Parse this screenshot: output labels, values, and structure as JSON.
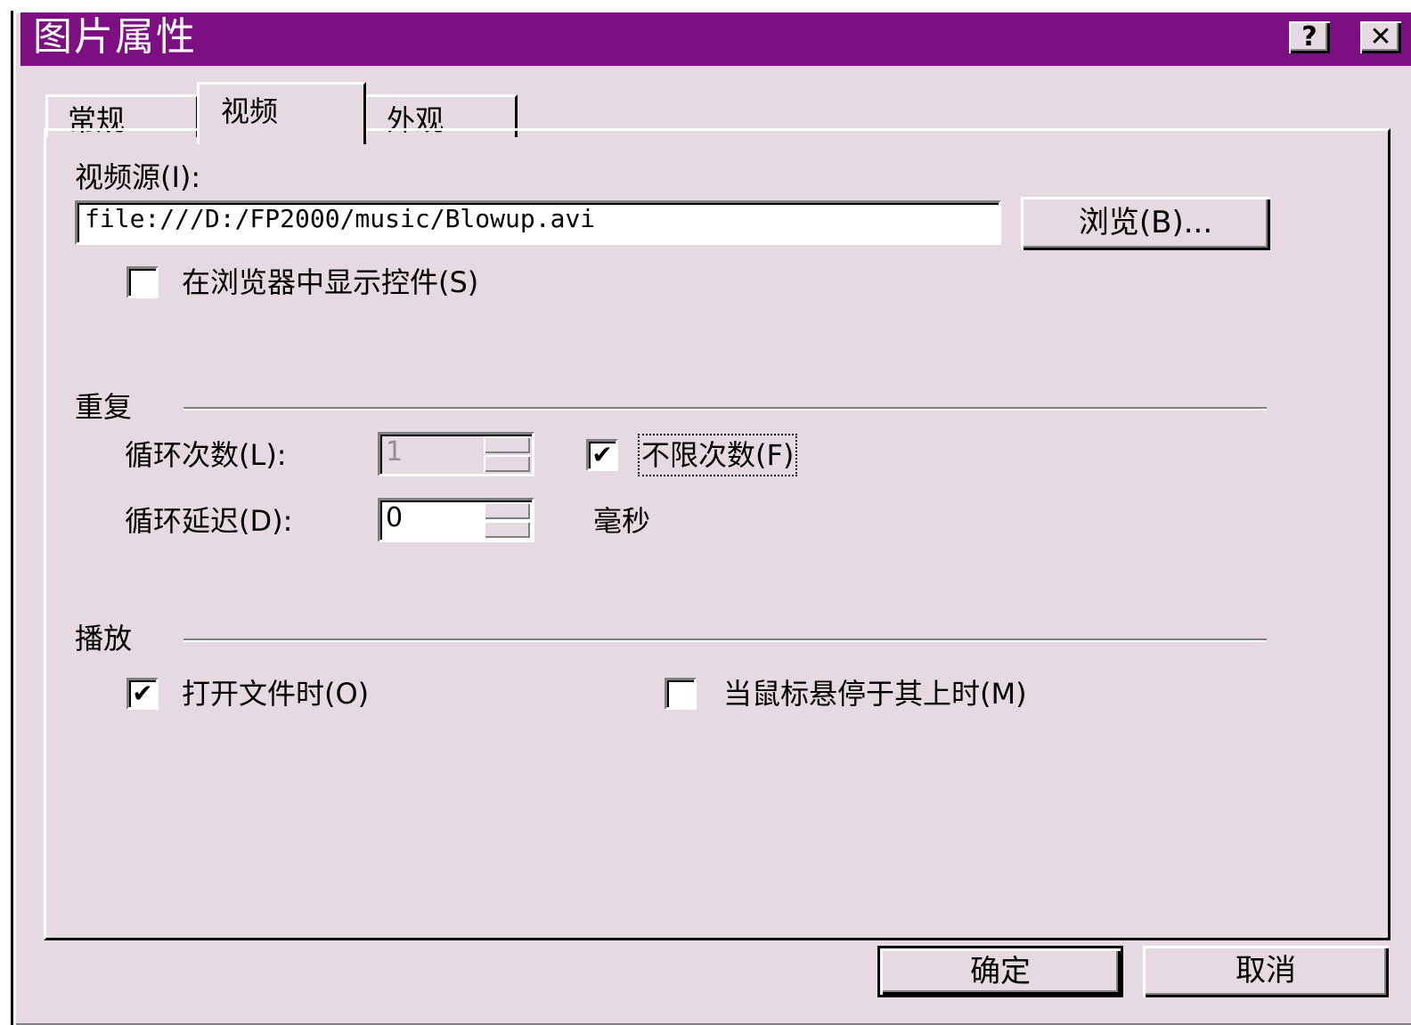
{
  "window": {
    "title": "图片属性",
    "help_button": "?",
    "close_button": "✕"
  },
  "tabs": [
    {
      "label": "常规",
      "active": false
    },
    {
      "label": "视频",
      "active": true
    },
    {
      "label": "外观",
      "active": false
    }
  ],
  "video": {
    "source_label": "视频源(I):",
    "source_value": "file:///D:/FP2000/music/Blowup.avi",
    "browse_button": "浏览(B)...",
    "show_controls_label": "在浏览器中显示控件(S)",
    "show_controls_checked": false
  },
  "repeat": {
    "group_label": "重复",
    "loop_count_label": "循环次数(L):",
    "loop_count_value": "1",
    "loop_count_disabled": true,
    "infinite_label": "不限次数(F)",
    "infinite_checked": true,
    "loop_delay_label": "循环延迟(D):",
    "loop_delay_value": "0",
    "loop_delay_unit": "毫秒"
  },
  "play": {
    "group_label": "播放",
    "on_open_label": "打开文件时(O)",
    "on_open_checked": true,
    "on_hover_label": "当鼠标悬停于其上时(M)",
    "on_hover_checked": false
  },
  "footer": {
    "ok_button": "确定",
    "cancel_button": "取消"
  },
  "colors": {
    "titlebar": "#7d0f82",
    "dialog_bg": "#e6d9e1"
  }
}
